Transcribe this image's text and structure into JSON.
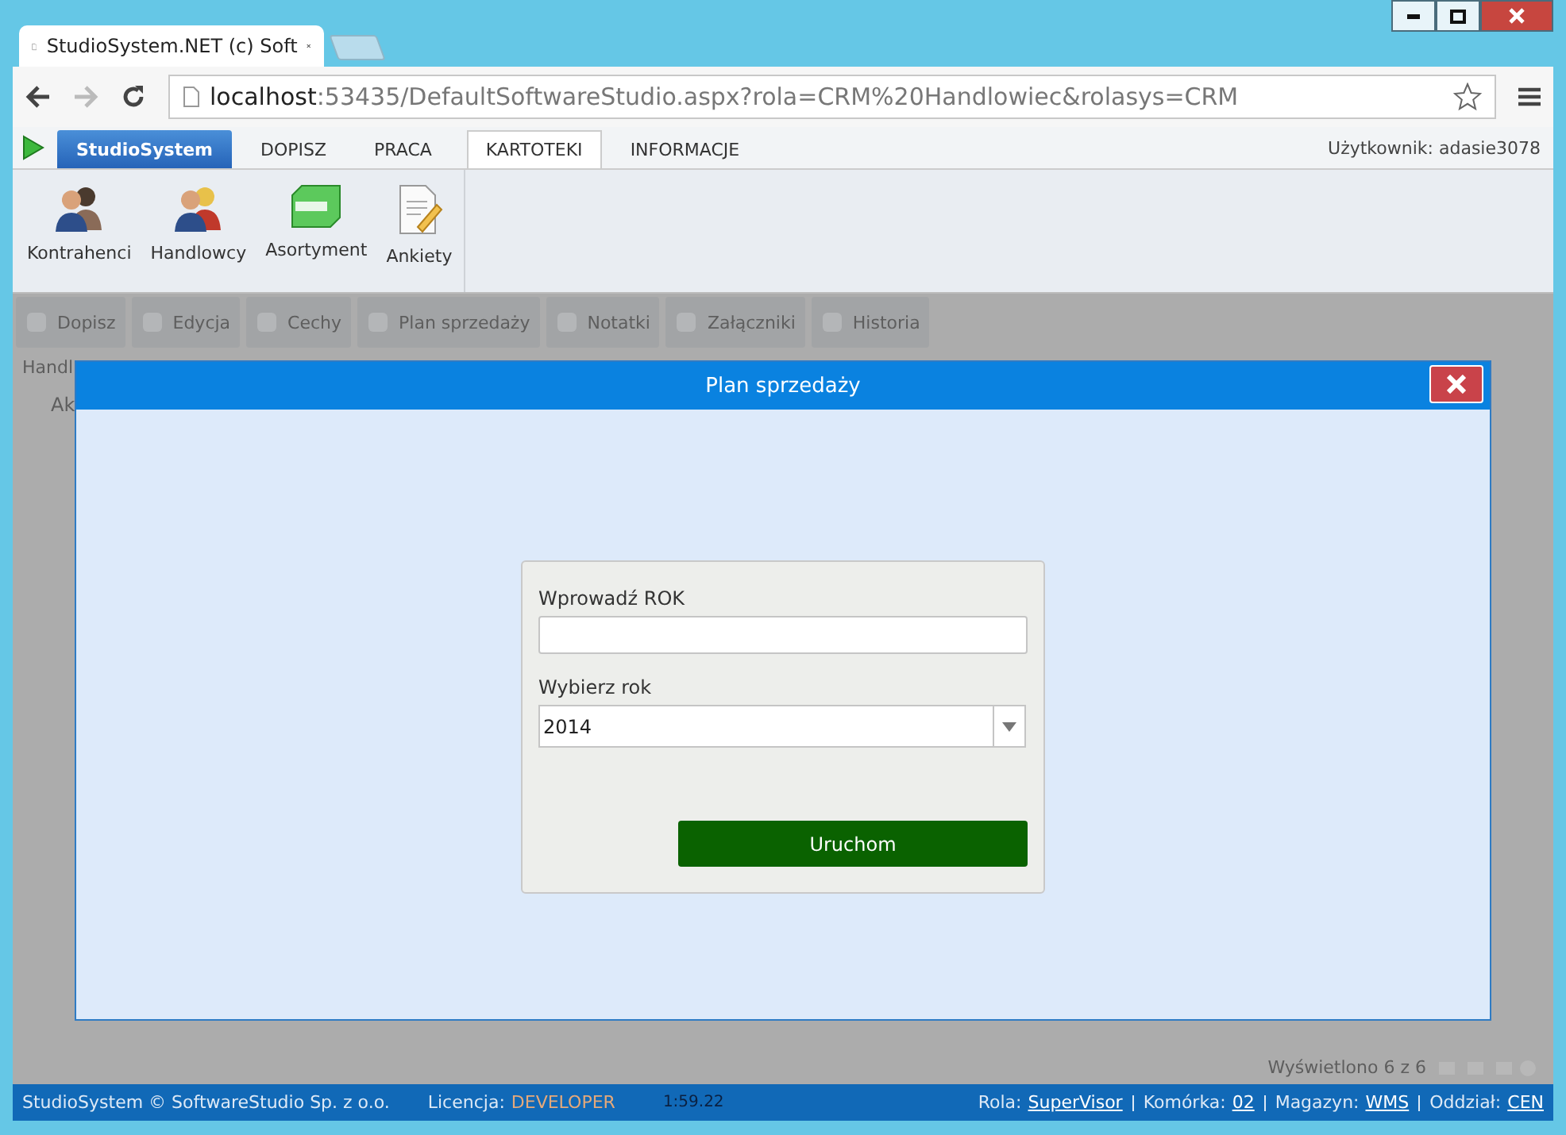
{
  "browser": {
    "tab_title": "StudioSystem.NET (c) Soft",
    "url_host": "localhost",
    "url_rest": ":53435/DefaultSoftwareStudio.aspx?rola=CRM%20Handlowiec&rolasys=CRM"
  },
  "nav": {
    "brand": "StudioSystem",
    "tabs": [
      {
        "label": "DOPISZ",
        "selected": false
      },
      {
        "label": "PRACA",
        "selected": false
      },
      {
        "label": "KARTOTEKI",
        "selected": true
      },
      {
        "label": "INFORMACJE",
        "selected": false
      }
    ],
    "user": "Użytkownik: adasie3078"
  },
  "ribbon": [
    {
      "label": "Kontrahenci",
      "kind": "people"
    },
    {
      "label": "Handlowcy",
      "kind": "people-mixed"
    },
    {
      "label": "Asortyment",
      "kind": "box"
    },
    {
      "label": "Ankiety",
      "kind": "document"
    }
  ],
  "background": {
    "toolbar": [
      "Dopisz",
      "Edycja",
      "Cechy",
      "Plan sprzedaży",
      "Notatki",
      "Załączniki",
      "Historia"
    ],
    "section_label": "Handl",
    "column_label": "Ak",
    "record_count": "Wyświetlono 6 z 6"
  },
  "dialog": {
    "title": "Plan sprzedaży",
    "year_label": "Wprowadź ROK",
    "select_label": "Wybierz rok",
    "select_value": "2014",
    "run_button": "Uruchom"
  },
  "status_bar": {
    "copyright": "StudioSystem © SoftwareStudio Sp. z o.o.",
    "license_label": "Licencja:",
    "license": "DEVELOPER",
    "time": "1:59.22",
    "fields": [
      {
        "label": "Rola:",
        "value": "SuperVisor"
      },
      {
        "label": "Komórka:",
        "value": "02"
      },
      {
        "label": "Magazyn:",
        "value": "WMS"
      },
      {
        "label": "Oddział:",
        "value": "CEN"
      }
    ]
  }
}
